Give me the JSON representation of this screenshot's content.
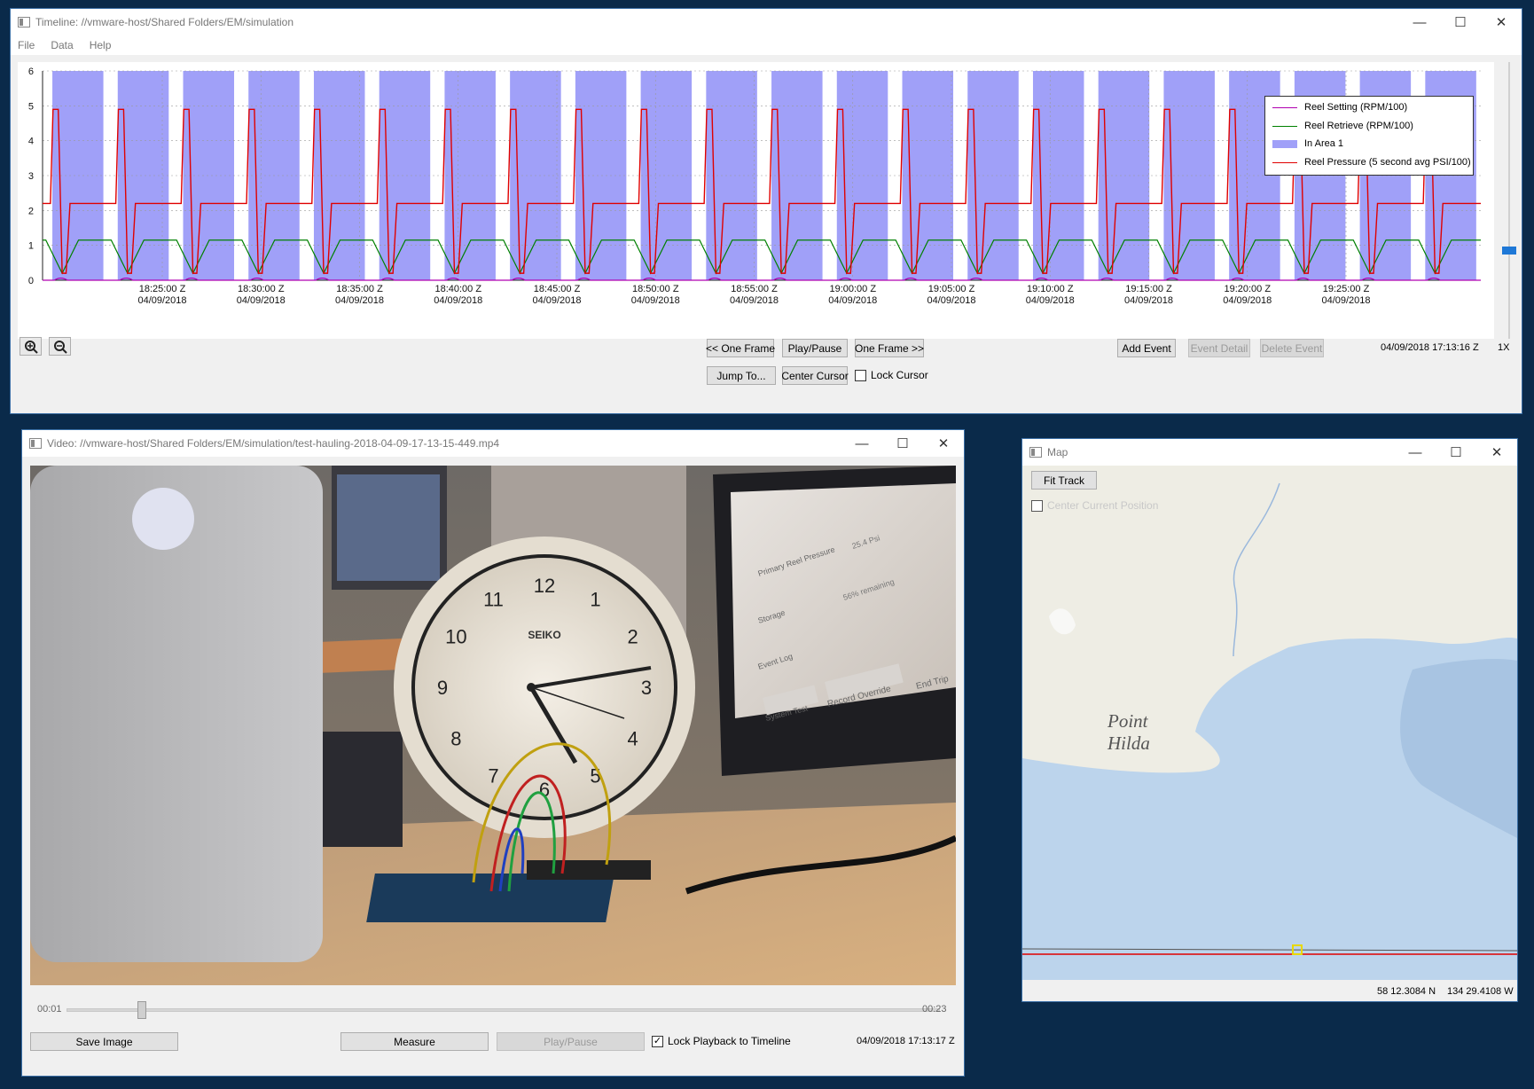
{
  "timeline": {
    "title": "Timeline: //vmware-host/Shared Folders/EM/simulation",
    "menu": [
      "File",
      "Data",
      "Help"
    ],
    "chart_data": {
      "type": "line",
      "ylim": [
        0,
        6
      ],
      "yticks": [
        "0",
        "1",
        "2",
        "3",
        "4",
        "5",
        "6"
      ],
      "xticks": [
        {
          "time": "18:25:00 Z",
          "date": "04/09/2018"
        },
        {
          "time": "18:30:00 Z",
          "date": "04/09/2018"
        },
        {
          "time": "18:35:00 Z",
          "date": "04/09/2018"
        },
        {
          "time": "18:40:00 Z",
          "date": "04/09/2018"
        },
        {
          "time": "18:45:00 Z",
          "date": "04/09/2018"
        },
        {
          "time": "18:50:00 Z",
          "date": "04/09/2018"
        },
        {
          "time": "18:55:00 Z",
          "date": "04/09/2018"
        },
        {
          "time": "19:00:00 Z",
          "date": "04/09/2018"
        },
        {
          "time": "19:05:00 Z",
          "date": "04/09/2018"
        },
        {
          "time": "19:10:00 Z",
          "date": "04/09/2018"
        },
        {
          "time": "19:15:00 Z",
          "date": "04/09/2018"
        },
        {
          "time": "19:20:00 Z",
          "date": "04/09/2018"
        },
        {
          "time": "19:25:00 Z",
          "date": "04/09/2018"
        }
      ],
      "cycles": 22,
      "series": [
        {
          "name": "Reel Setting (RPM/100)",
          "color": "#b000b0",
          "baseline": 0.0
        },
        {
          "name": "Reel Retrieve (RPM/100)",
          "color": "#008000",
          "baseline": 1.15,
          "low": 0.2
        },
        {
          "name": "In Area 1",
          "color": "#a0a0f8",
          "type": "area"
        },
        {
          "name": "Reel Pressure (5 second avg PSI/100)",
          "color": "#e00000",
          "baseline": 2.2,
          "peak": 4.9,
          "low": 0.2
        }
      ],
      "legend_position": "top-right",
      "grid": true
    },
    "buttons": {
      "prev_frame": "<< One Frame",
      "play_pause": "Play/Pause",
      "next_frame": "One Frame >>",
      "jump_to": "Jump To...",
      "center_cursor": "Center Cursor",
      "lock_cursor": "Lock Cursor",
      "add_event": "Add Event",
      "event_detail": "Event Detail",
      "delete_event": "Delete Event"
    },
    "timestamp": "04/09/2018 17:13:16 Z",
    "speed": "1X"
  },
  "video": {
    "title": "Video: //vmware-host/Shared Folders/EM/simulation/test-hauling-2018-04-09-17-13-15-449.mp4",
    "scene": {
      "clock_brand": "SEIKO",
      "clock_numbers": [
        "12",
        "1",
        "2",
        "3",
        "4",
        "5",
        "6",
        "7",
        "8",
        "9",
        "10",
        "11"
      ],
      "screen_labels": [
        "Primary Reel Pressure",
        "Storage",
        "Event Log",
        "System Test",
        "Record Override",
        "End Trip"
      ],
      "screen_values": [
        "25.4 Psi",
        "56% remaining"
      ]
    },
    "start_time": "00:01",
    "end_time": "00:23",
    "progress": 0.08,
    "buttons": {
      "save_image": "Save Image",
      "measure": "Measure",
      "play_pause": "Play/Pause"
    },
    "lock_playback": "Lock Playback to Timeline",
    "timestamp": "04/09/2018 17:13:17 Z"
  },
  "map": {
    "title": "Map",
    "fit_track": "Fit Track",
    "center_current": "Center Current Position",
    "place_name_1": "Point",
    "place_name_2": "Hilda",
    "lat": "58 12.3084 N",
    "lon": "134 29.4108 W"
  }
}
